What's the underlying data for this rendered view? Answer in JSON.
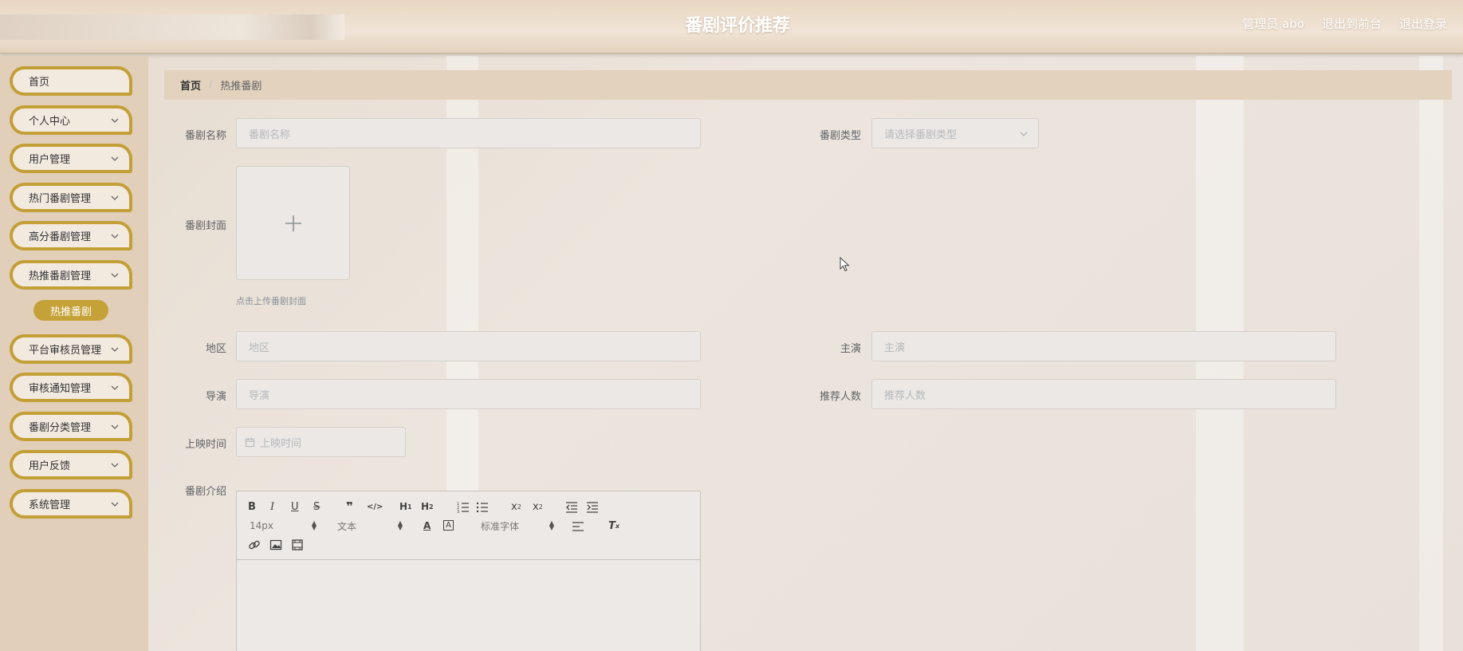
{
  "header": {
    "title": "番剧评价推荐",
    "user": "管理员 abo",
    "to_front": "退出到前台",
    "logout": "退出登录"
  },
  "sidebar": {
    "items": [
      {
        "label": "首页",
        "chevron": false
      },
      {
        "label": "个人中心",
        "chevron": true
      },
      {
        "label": "用户管理",
        "chevron": true
      },
      {
        "label": "热门番剧管理",
        "chevron": true
      },
      {
        "label": "高分番剧管理",
        "chevron": true
      },
      {
        "label": "热推番剧管理",
        "chevron": true
      },
      {
        "label": "平台审核员管理",
        "chevron": true
      },
      {
        "label": "审核通知管理",
        "chevron": true
      },
      {
        "label": "番剧分类管理",
        "chevron": true
      },
      {
        "label": "用户反馈",
        "chevron": true
      },
      {
        "label": "系统管理",
        "chevron": true
      }
    ],
    "active_sub": "热推番剧"
  },
  "breadcrumb": {
    "home": "首页",
    "separator": "/",
    "current": "热推番剧"
  },
  "form": {
    "name": {
      "label": "番剧名称",
      "placeholder": "番剧名称"
    },
    "type": {
      "label": "番剧类型",
      "placeholder": "请选择番剧类型"
    },
    "cover": {
      "label": "番剧封面",
      "hint": "点击上传番剧封面"
    },
    "region": {
      "label": "地区",
      "placeholder": "地区"
    },
    "lead": {
      "label": "主演",
      "placeholder": "主演"
    },
    "director": {
      "label": "导演",
      "placeholder": "导演"
    },
    "recommend_count": {
      "label": "推荐人数",
      "placeholder": "推荐人数"
    },
    "release_time": {
      "label": "上映时间",
      "placeholder": "上映时间"
    },
    "intro": {
      "label": "番剧介绍"
    }
  },
  "editor": {
    "font_size": "14px",
    "block_format": "文本",
    "font_family": "标准字体"
  },
  "colors": {
    "accent": "#c39f37",
    "sidebar_bg": "#e2cfba",
    "breadcrumb_bg": "#e3d2bd"
  }
}
